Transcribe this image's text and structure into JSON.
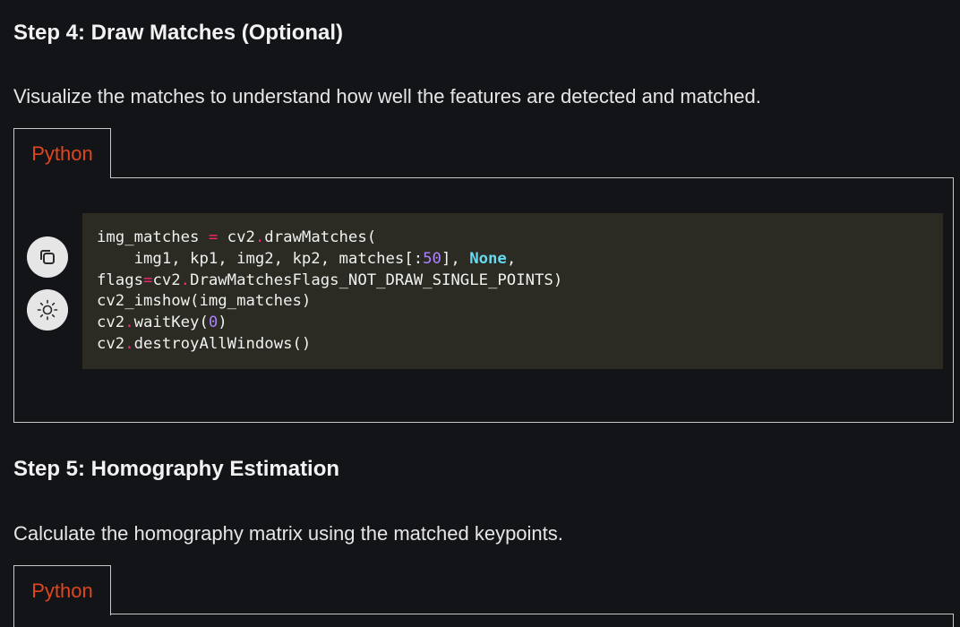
{
  "step4": {
    "title": "Step 4: Draw Matches (Optional)",
    "description": "Visualize the matches to understand how well the features are detected and matched.",
    "tab_label": "Python",
    "copy_icon": "copy-icon",
    "theme_icon": "sun-icon",
    "code": {
      "l1_a": "img_matches ",
      "l1_op": "=",
      "l1_b": " cv2",
      "l1_dot": ".",
      "l1_c": "drawMatches(",
      "l2_a": "    img1, kp1, img2, kp2, matches[:",
      "l2_num": "50",
      "l2_b": "], ",
      "l2_kw": "None",
      "l2_c": ",",
      "l3_a": "flags",
      "l3_op": "=",
      "l3_b": "cv2",
      "l3_dot": ".",
      "l3_c": "DrawMatchesFlags_NOT_DRAW_SINGLE_POINTS)",
      "l4_a": "cv2_imshow(img_matches)",
      "l5_a": "cv2",
      "l5_dot": ".",
      "l5_b": "waitKey(",
      "l5_num": "0",
      "l5_c": ")",
      "l6_a": "cv2",
      "l6_dot": ".",
      "l6_b": "destroyAllWindows()"
    }
  },
  "step5": {
    "title": "Step 5: Homography Estimation",
    "description": "Calculate the homography matrix using the matched keypoints.",
    "tab_label": "Python"
  },
  "colors": {
    "background": "#131417",
    "tab_text": "#e0461d",
    "code_background": "#2b2b24"
  }
}
